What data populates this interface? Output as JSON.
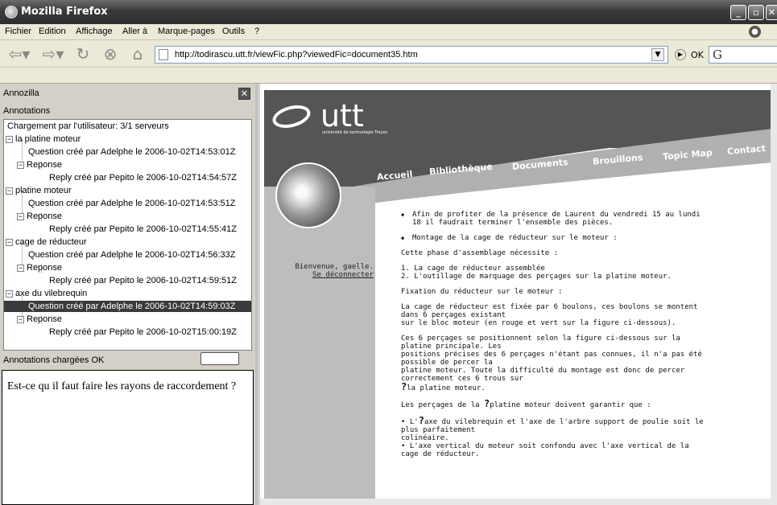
{
  "window": {
    "title": "Mozilla Firefox"
  },
  "menu": [
    "Fichier",
    "Edition",
    "Affichage",
    "Aller à",
    "Marque-pages",
    "Outils",
    "?"
  ],
  "toolbar": {
    "url": "http://todirascu.utt.fr/viewFic.php?viewedFic=document35.htm",
    "ok_label": "OK",
    "search_glyph": "G"
  },
  "sidebar": {
    "header": "Annozilla",
    "subheader": "Annotations",
    "tree": [
      {
        "text": "Chargement par l'utilisateur: 3/1 serveurs"
      },
      {
        "text": "la platine moteur"
      },
      {
        "text": "Question créé par Adelphe le 2006-10-02T14:53:01Z"
      },
      {
        "text": "Reponse"
      },
      {
        "text": "Reply créé par Pepito le 2006-10-02T14:54:57Z"
      },
      {
        "text": "platine moteur"
      },
      {
        "text": "Question créé par Adelphe le 2006-10-02T14:53:51Z"
      },
      {
        "text": "Reponse"
      },
      {
        "text": "Reply créé par Pepito le 2006-10-02T14:55:41Z"
      },
      {
        "text": "cage de réducteur"
      },
      {
        "text": "Question créé par Adelphe le 2006-10-02T14:56:33Z"
      },
      {
        "text": "Reponse"
      },
      {
        "text": "Reply créé par Pepito le 2006-10-02T14:59:51Z"
      },
      {
        "text": "axe du vilebrequin"
      },
      {
        "text": "Question créé par Adelphe le 2006-10-02T14:59:03Z"
      },
      {
        "text": "Reponse"
      },
      {
        "text": "Reply créé par Pepito le 2006-10-02T15:00:19Z"
      }
    ],
    "status": "Annotations chargées OK",
    "note": "Est-ce qu il faut faire les rayons de raccordement ?"
  },
  "page": {
    "logo": "utt",
    "logo_sub": "université de technologie Troyes",
    "nav": [
      "Accueil",
      "Bibliothèque",
      "Documents",
      "Brouillons",
      "Topic Map",
      "Contact"
    ],
    "welcome": "Bienvenue, gaelle.",
    "logout": "Se déconnecter",
    "bullet1": "Afin de profiter de la présence de Laurent du vendredi 15 au lundi 18 il faudrait terminer l'ensemble des pièces.",
    "bullet2": "",
    "bullet3": "Montage de la cage de réducteur sur le moteur :",
    "p1": "Cette phase d'assemblage nécessite :",
    "p2a": "1. La cage de réducteur assemblée",
    "p2b": "2. L'outillage de marquage des perçages sur la platine moteur.",
    "p3": "Fixation du réducteur sur le moteur :",
    "p4a": "La cage de réducteur est fixée par 6 boulons, ces boulons se montent dans 6 perçages existant",
    "p4b": "sur le bloc moteur (en rouge et vert sur la figure ci-dessous).",
    "p5a": "Ces 6 perçages se positionnent selon la figure ci-dessous sur la platine principale. Les",
    "p5b": "positions précises des 6 perçages n'étant pas connues, il n'a pas été possible de percer la",
    "p5c": "platine moteur. Toute la difficulté du montage est donc de percer correctement ces 6 trous sur",
    "p5d_mark": "?",
    "p5d": "la platine moteur.",
    "p6_pre": "Les perçages de la ",
    "p6_mark": "?",
    "p6_post": "platine moteur doivent garantir que :",
    "p7_pre": "• L'",
    "p7_mark": "?",
    "p7_post": "axe du vilebrequin et l'axe de l'arbre support de poulie soit le plus parfaitement",
    "p7b": "colinéaire.",
    "p8a": "• L'axe vertical du moteur soit confondu avec l'axe vertical de la cage de réducteur."
  }
}
